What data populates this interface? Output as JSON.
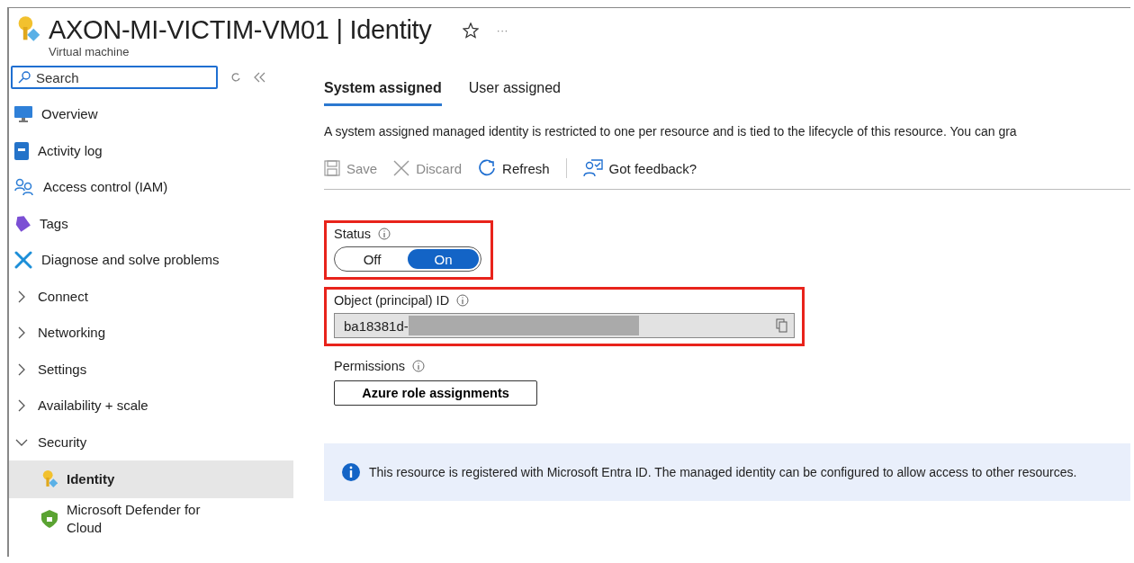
{
  "header": {
    "title": "AXON-MI-VICTIM-VM01",
    "separator": "|",
    "section": "Identity",
    "subtitle": "Virtual machine",
    "more": "···"
  },
  "sidebar": {
    "search": {
      "placeholder": "Search"
    },
    "items": [
      {
        "kind": "link",
        "label": "Overview"
      },
      {
        "kind": "link",
        "label": "Activity log"
      },
      {
        "kind": "link",
        "label": "Access control (IAM)"
      },
      {
        "kind": "link",
        "label": "Tags"
      },
      {
        "kind": "link",
        "label": "Diagnose and solve problems"
      },
      {
        "kind": "group",
        "label": "Connect",
        "expanded": false
      },
      {
        "kind": "group",
        "label": "Networking",
        "expanded": false
      },
      {
        "kind": "group",
        "label": "Settings",
        "expanded": false
      },
      {
        "kind": "group",
        "label": "Availability + scale",
        "expanded": false
      },
      {
        "kind": "group",
        "label": "Security",
        "expanded": true,
        "children": [
          {
            "label": "Identity",
            "selected": true
          },
          {
            "label": "Microsoft Defender for Cloud",
            "selected": false
          }
        ]
      }
    ]
  },
  "tabs": [
    {
      "label": "System assigned",
      "selected": true
    },
    {
      "label": "User assigned",
      "selected": false
    }
  ],
  "description": "A system assigned managed identity is restricted to one per resource and is tied to the lifecycle of this resource. You can gra",
  "toolbar": [
    {
      "label": "Save",
      "disabled": true
    },
    {
      "label": "Discard",
      "disabled": true
    },
    {
      "label": "Refresh",
      "disabled": false
    },
    {
      "label": "Got feedback?",
      "disabled": false
    }
  ],
  "status": {
    "label": "Status",
    "options": [
      {
        "label": "Off",
        "selected": false
      },
      {
        "label": "On",
        "selected": true
      }
    ]
  },
  "object_id": {
    "label": "Object (principal) ID",
    "value": "ba18381d-"
  },
  "permissions": {
    "label": "Permissions",
    "button": "Azure role assignments"
  },
  "info": "This resource is registered with Microsoft Entra ID. The managed identity can be configured to allow access to other resources."
}
